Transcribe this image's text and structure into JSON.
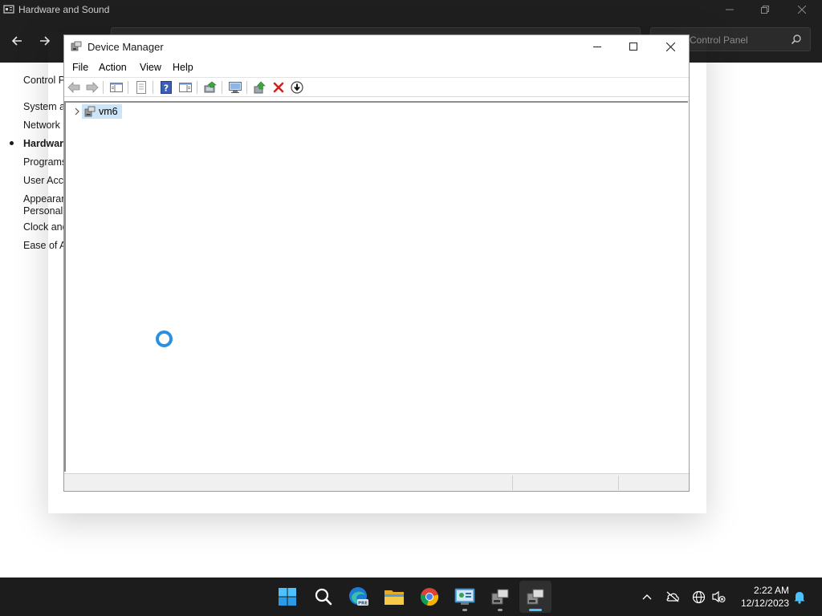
{
  "control_panel": {
    "window_title": "Hardware and Sound",
    "search_placeholder": "Control Panel",
    "left_nav": [
      {
        "label": "Control Panel Home",
        "active": false
      },
      {
        "label": "System and Security",
        "active": false
      },
      {
        "label": "Network and Internet",
        "active": false
      },
      {
        "label": "Hardware and Sound",
        "active": true
      },
      {
        "label": "Programs",
        "active": false
      },
      {
        "label": "User Accounts",
        "active": false
      },
      {
        "label": "Appearance and",
        "active": false
      },
      {
        "label": "Personalization",
        "active": false
      },
      {
        "label": "Clock and Region",
        "active": false
      },
      {
        "label": "Ease of Access",
        "active": false
      }
    ]
  },
  "device_manager": {
    "title": "Device Manager",
    "menu": [
      "File",
      "Action",
      "View",
      "Help"
    ],
    "toolbar_icons": [
      "back-icon",
      "forward-icon",
      "show-hide-console-tree-icon",
      "properties-icon",
      "help-icon",
      "show-hide-action-pane-icon",
      "update-driver-icon",
      "scan-hardware-changes-icon",
      "enable-device-icon",
      "uninstall-device-icon",
      "disable-device-icon"
    ],
    "tree": {
      "root_label": "vm6",
      "expanded": false,
      "selected": true
    }
  },
  "taskbar": {
    "apps": [
      "start-icon",
      "search-icon",
      "edge-beta-icon",
      "file-explorer-icon",
      "chrome-icon",
      "control-panel-icon",
      "device-manager-icon",
      "device-manager-icon"
    ],
    "clock_time": "2:22 AM",
    "clock_date": "12/12/2023"
  },
  "colors": {
    "accent": "#4cc2ff",
    "selection": "#cce4f7",
    "taskbar": "#1c1c1c",
    "busy_cursor": "#2d8fe0"
  }
}
